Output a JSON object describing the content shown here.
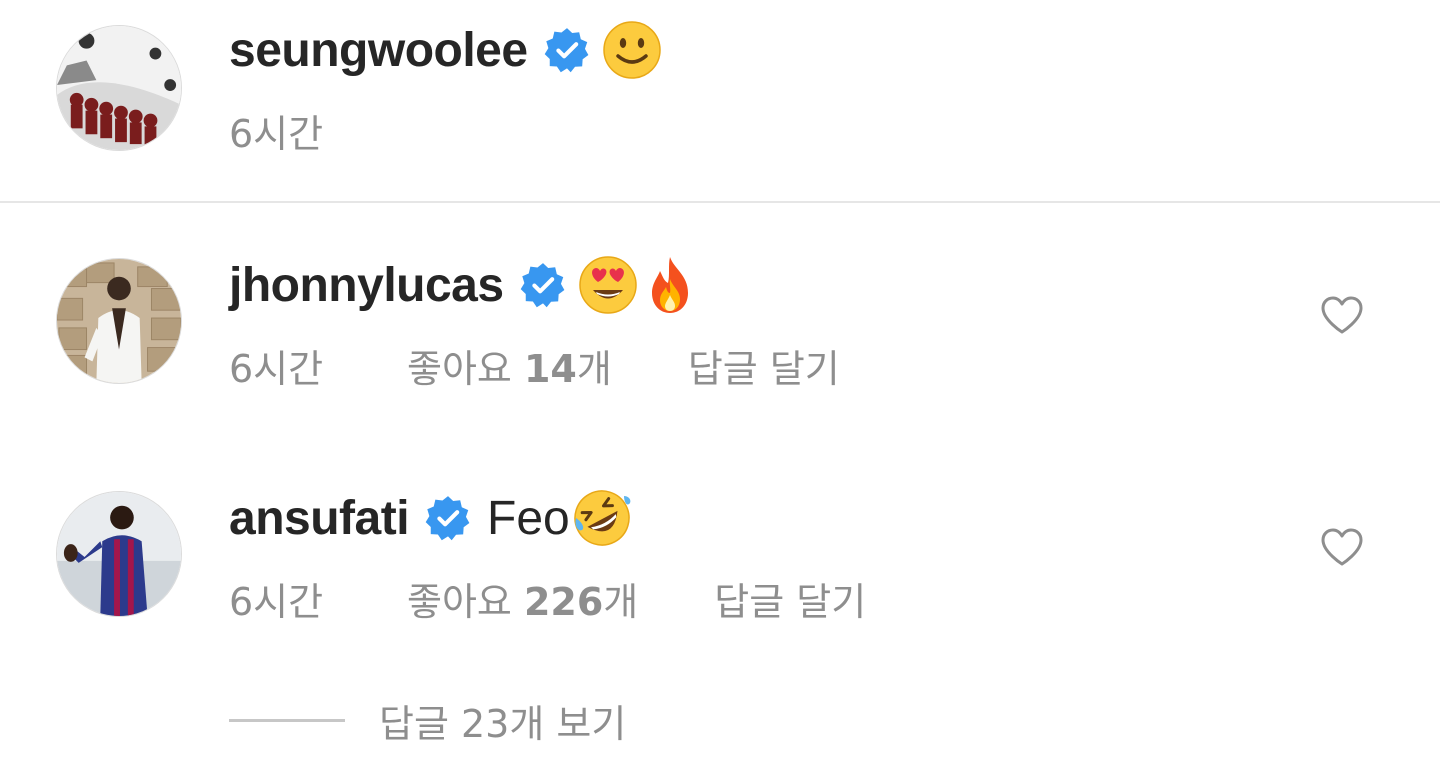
{
  "comments": [
    {
      "username": "seungwoolee",
      "verified": true,
      "text": "",
      "emojis": [
        "slightly-smiling-face"
      ],
      "time": "6시간",
      "likes": "",
      "reply": ""
    },
    {
      "username": "jhonnylucas",
      "verified": true,
      "text": "",
      "emojis": [
        "heart-eyes-face",
        "fire"
      ],
      "time": "6시간",
      "likes_prefix": "좋아요 ",
      "likes_count": "14",
      "likes_suffix": "개",
      "reply": "답글 달기"
    },
    {
      "username": "ansufati",
      "verified": true,
      "text": "Feo",
      "emojis": [
        "rolling-on-floor-laughing"
      ],
      "time": "6시간",
      "likes_prefix": "좋아요 ",
      "likes_count": "226",
      "likes_suffix": "개",
      "reply": "답글 달기"
    }
  ],
  "view_replies": "답글 23개 보기",
  "colors": {
    "text": "#262626",
    "secondary": "#8e8e8e",
    "verified_blue": "#3897f0",
    "divider": "#e6e6e6"
  }
}
